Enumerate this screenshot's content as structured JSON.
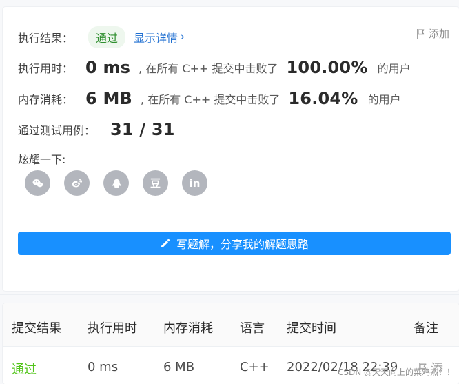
{
  "summary": {
    "result_label": "执行结果：",
    "status": "通过",
    "details_link": "显示详情",
    "add_note": "添加",
    "runtime_label": "执行用时：",
    "runtime_value": "0 ms",
    "runtime_desc": ", 在所有 C++ 提交中击败了",
    "runtime_percent": "100.00%",
    "runtime_suffix": "的用户",
    "memory_label": "内存消耗：",
    "memory_value": "6 MB",
    "memory_desc": ", 在所有 C++ 提交中击败了",
    "memory_percent": "16.04%",
    "memory_suffix": "的用户",
    "testcases_label": "通过测试用例：",
    "testcases_value": "31 / 31",
    "share_label": "炫耀一下:",
    "share_icons": [
      "wechat-icon",
      "weibo-icon",
      "qq-icon",
      "douban-icon",
      "linkedin-icon"
    ],
    "share_icon_texts": {
      "douban": "豆",
      "linkedin": "in"
    },
    "write_button": "写题解，分享我的解题思路"
  },
  "table": {
    "headers": [
      "提交结果",
      "执行用时",
      "内存消耗",
      "语言",
      "提交时间",
      "备注"
    ],
    "row": {
      "result": "通过",
      "runtime": "0 ms",
      "memory": "6 MB",
      "language": "C++",
      "submitted_at": "2022/02/18 22:39",
      "note": "添"
    }
  },
  "watermark": "CSDN @天天向上的菜鸡杰！！",
  "colors": {
    "accent": "#1890ff",
    "success": "#52c41a",
    "link": "#1f6fd1",
    "icon_bg": "#b3b6bd"
  }
}
